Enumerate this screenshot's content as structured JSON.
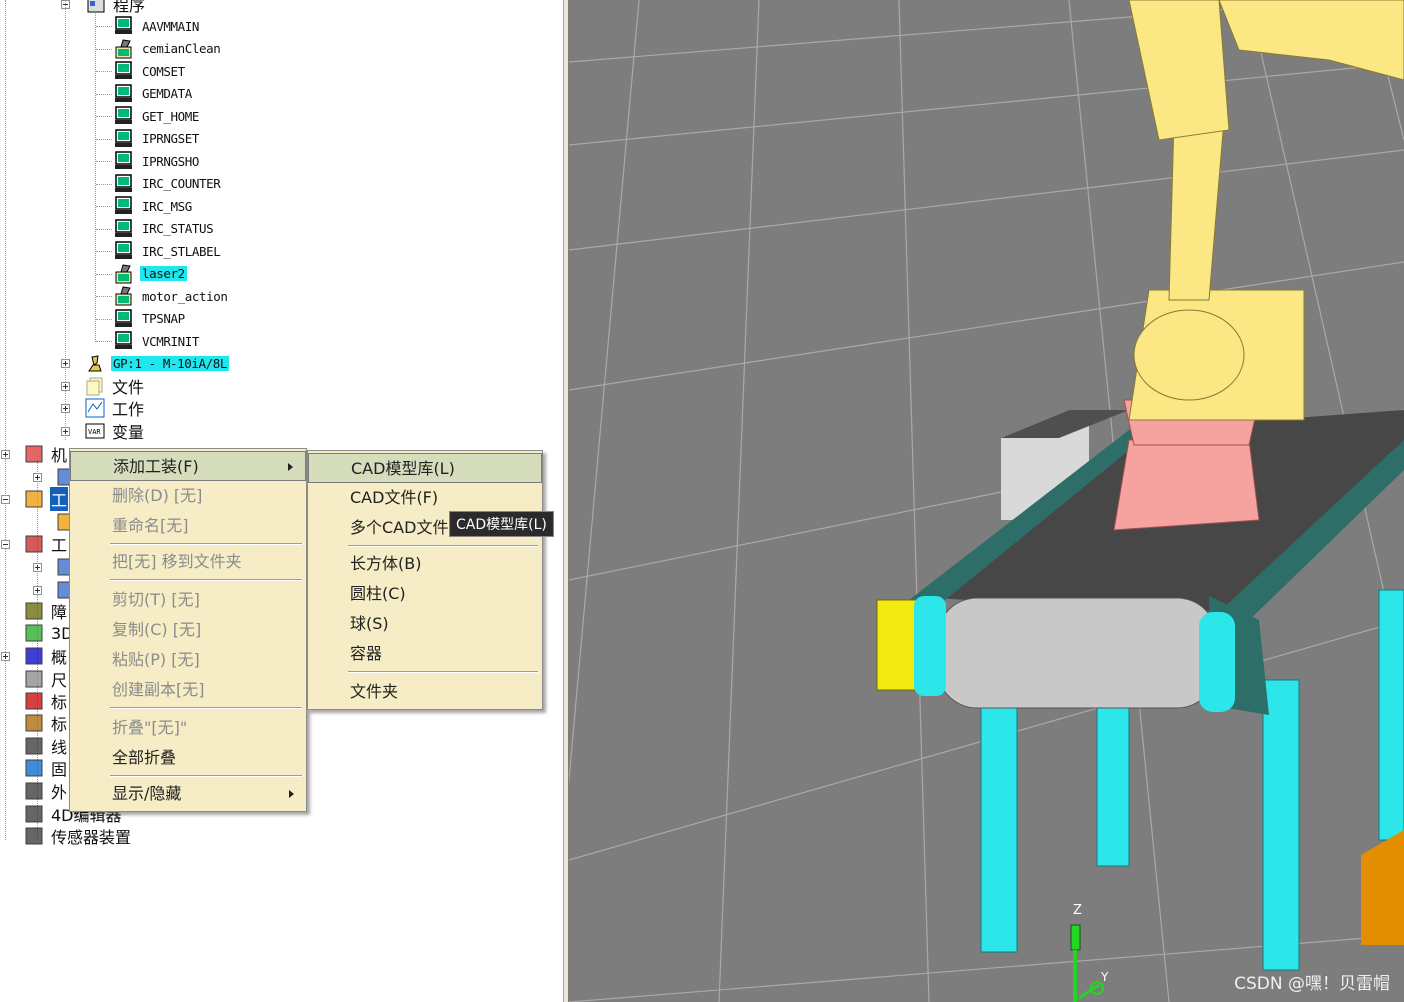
{
  "tree": {
    "program_folder": "程序",
    "programs": [
      {
        "name": "AAVMMAIN",
        "kind": "tp"
      },
      {
        "name": "cemianClean",
        "kind": "karel"
      },
      {
        "name": "COMSET",
        "kind": "tp"
      },
      {
        "name": "GEMDATA",
        "kind": "tp"
      },
      {
        "name": "GET_HOME",
        "kind": "tp"
      },
      {
        "name": "IPRNGSET",
        "kind": "tp"
      },
      {
        "name": "IPRNGSHO",
        "kind": "tp"
      },
      {
        "name": "IRC_COUNTER",
        "kind": "tp"
      },
      {
        "name": "IRC_MSG",
        "kind": "tp"
      },
      {
        "name": "IRC_STATUS",
        "kind": "tp"
      },
      {
        "name": "IRC_STLABEL",
        "kind": "tp"
      },
      {
        "name": "laser2",
        "kind": "karel",
        "highlighted": true
      },
      {
        "name": "motor_action",
        "kind": "karel"
      },
      {
        "name": "TPSNAP",
        "kind": "tp"
      },
      {
        "name": "VCMRINIT",
        "kind": "tp"
      }
    ],
    "group_label": "GP:1 - M-10iA/8L",
    "files_label": "文件",
    "work_label": "工作",
    "vars_label": "变量",
    "cell_items": [
      {
        "label": "机",
        "icon": "robot-arm-icon"
      },
      {
        "label": "",
        "icon": "tool-icon"
      },
      {
        "label": "工",
        "icon": "fixture-icon",
        "selected": true
      },
      {
        "label": "",
        "icon": "frame-icon"
      },
      {
        "label": "工",
        "icon": "workpiece-icon"
      },
      {
        "label": "",
        "icon": "part-icon"
      },
      {
        "label": "",
        "icon": "part-icon"
      },
      {
        "label": "障",
        "icon": "obstacle-icon"
      },
      {
        "label": "3D",
        "icon": "people-icon"
      },
      {
        "label": "概",
        "icon": "layout-icon"
      },
      {
        "label": "尺",
        "icon": "ruler-icon"
      },
      {
        "label": "标",
        "icon": "target-icon"
      },
      {
        "label": "标",
        "icon": "target-robot-icon"
      },
      {
        "label": "线",
        "icon": "spline-icon"
      },
      {
        "label": "固",
        "icon": "flag-icon"
      },
      {
        "label": "外",
        "icon": "external-icon"
      },
      {
        "label": "4D编辑器",
        "icon": "4d-editor-icon"
      },
      {
        "label": "传感器装置",
        "icon": "sensor-icon"
      }
    ]
  },
  "context_menu": {
    "items": [
      {
        "label": "添加工装(F)",
        "state": "selected",
        "submenu": true
      },
      {
        "label": "删除(D) [无]",
        "state": "disabled"
      },
      {
        "label": "重命名[无]",
        "state": "disabled"
      },
      {
        "sep": true
      },
      {
        "label": "把[无] 移到文件夹",
        "state": "disabled"
      },
      {
        "sep": true
      },
      {
        "label": "剪切(T) [无]",
        "state": "disabled"
      },
      {
        "label": "复制(C) [无]",
        "state": "disabled"
      },
      {
        "label": "粘贴(P) [无]",
        "state": "disabled"
      },
      {
        "label": "创建副本[无]",
        "state": "disabled"
      },
      {
        "sep": true
      },
      {
        "label": "折叠\"[无]\"",
        "state": "disabled"
      },
      {
        "label": "全部折叠",
        "state": "enabled"
      },
      {
        "sep": true
      },
      {
        "label": "显示/隐藏",
        "state": "enabled",
        "submenu": true
      }
    ]
  },
  "submenu": {
    "items": [
      {
        "label": "CAD模型库(L)",
        "state": "selected"
      },
      {
        "label": "CAD文件(F)",
        "state": "enabled"
      },
      {
        "label": "多个CAD文件",
        "state": "enabled"
      },
      {
        "sep": true
      },
      {
        "label": "长方体(B)",
        "state": "enabled"
      },
      {
        "label": "圆柱(C)",
        "state": "enabled"
      },
      {
        "label": "球(S)",
        "state": "enabled"
      },
      {
        "label": "容器",
        "state": "enabled"
      },
      {
        "sep": true
      },
      {
        "label": "文件夹",
        "state": "enabled"
      }
    ]
  },
  "tooltip": "CAD模型库(L)",
  "viewport": {
    "axis_z": "Z",
    "axis_y": "Y",
    "colors": {
      "floor": "#7d7d7d",
      "grid": "#a9a9a9",
      "robot": "#fbe783",
      "robot_base": "#f6a3a0",
      "conveyor": "#2e6e69",
      "roller": "#c8c8c8",
      "legs": "#2de6ea",
      "roller_end": "#f2ea10",
      "box": "#e28e00"
    }
  },
  "watermark": "CSDN @嘿！贝雷帽"
}
